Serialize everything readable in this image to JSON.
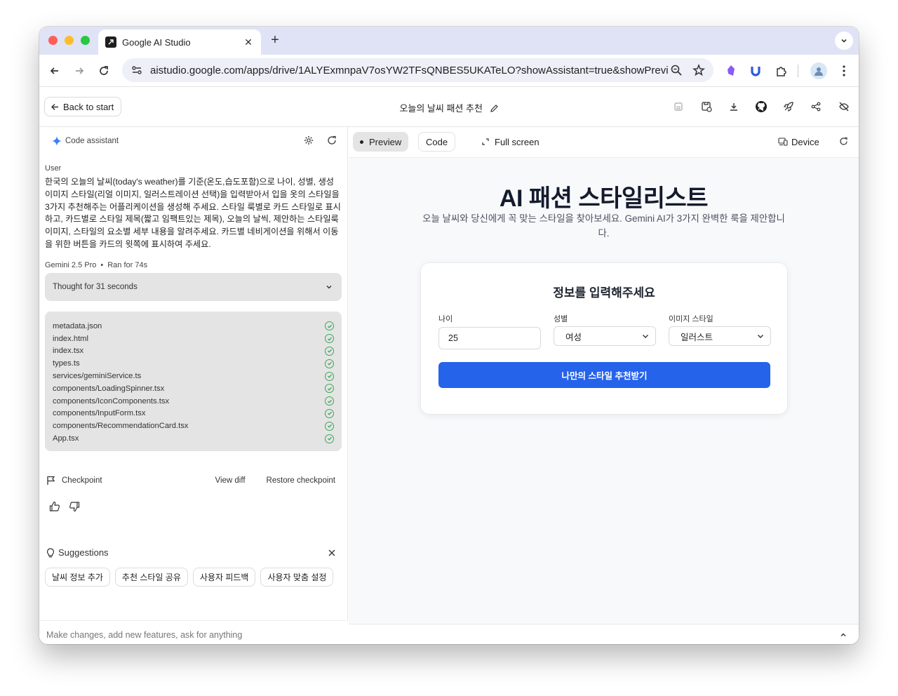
{
  "browser": {
    "tab_title": "Google AI Studio",
    "new_tab_symbol": "+",
    "close_symbol": "✕",
    "url_domain": "aistudio.google.com",
    "url_path": "/apps/drive/1ALYExmnpaV7osYW2TFsQNBES5UKATeLO?showAssistant=true&showPrevie..."
  },
  "header": {
    "back_label": "Back to start",
    "title": "오늘의 날씨 패션 추천"
  },
  "assistant": {
    "title": "Code assistant",
    "user_label": "User",
    "user_message": "한국의 오늘의 날씨(today's weather)를 기준(온도,습도포함)으로 나이, 성별, 생성 이미지 스타일(리얼 이미지, 일러스트레이션 선택)을 입력받아서 입을 옷의 스타일을 3가지 추천해주는 어플리케이션을 생성해 주세요. 스타일 룩별로 카드 스타일로 표시하고, 카드별로 스타일 제목(짧고 임팩트있는 제목), 오늘의 날씩, 제안하는 스타일룩 이미지, 스타일의 요소별 세부 내용을 알려주세요. 카드별 네비게이션을 위해서 이동을 위한 버튼을 카드의 윗쪽에 표시하여 주세요.",
    "model": "Gemini 2.5 Pro",
    "separator": "•",
    "ran_for": "Ran for 74s",
    "thought": "Thought for 31 seconds",
    "files": [
      "metadata.json",
      "index.html",
      "index.tsx",
      "types.ts",
      "services/geminiService.ts",
      "components/LoadingSpinner.tsx",
      "components/IconComponents.tsx",
      "components/InputForm.tsx",
      "components/RecommendationCard.tsx",
      "App.tsx"
    ],
    "checkpoint_label": "Checkpoint",
    "view_diff": "View diff",
    "restore_checkpoint": "Restore checkpoint",
    "suggestions_label": "Suggestions",
    "suggestions": [
      "날씨 정보 추가",
      "추천 스타일 공유",
      "사용자 피드백",
      "사용자 맞춤 설정"
    ],
    "composer_placeholder": "Make changes, add new features, ask for anything"
  },
  "preview": {
    "tabs": {
      "preview": "Preview",
      "code": "Code",
      "fullscreen": "Full screen",
      "device": "Device"
    },
    "hero_title": "AI 패션 스타일리스트",
    "hero_subtitle": "오늘 날씨와 당신에게 꼭 맞는 스타일을 찾아보세요. Gemini AI가 3가지 완벽한 룩을 제안합니다.",
    "form_title": "정보를 입력해주세요",
    "age_label": "나이",
    "age_value": "25",
    "gender_label": "성별",
    "gender_value": "여성",
    "style_label": "이미지 스타일",
    "style_value": "일러스트",
    "submit_label": "나만의 스타일 추천받기"
  },
  "colors": {
    "accent": "#2563eb",
    "check": "#3aa757",
    "tabbar": "#dfe3f5"
  }
}
